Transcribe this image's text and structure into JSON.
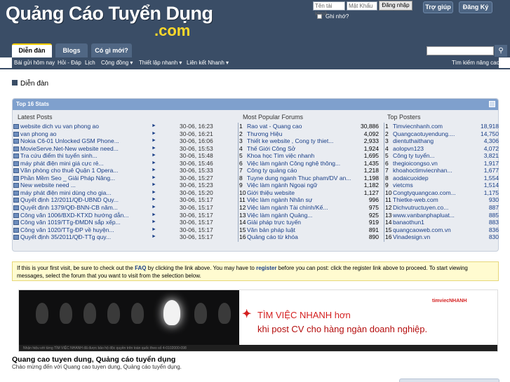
{
  "header": {
    "logo_title": "Quảng Cáo Tuyển Dụng",
    "logo_sub": ".com",
    "username_placeholder": "Tên tài khoả",
    "password_placeholder": "Mật Khẩu",
    "login_label": "Đăng nhập",
    "remember_label": "Ghi nhớ?",
    "help_label": "Trợ giúp",
    "register_label": "Đăng Ký"
  },
  "nav": {
    "tabs": [
      "Diễn đàn",
      "Blogs",
      "Có gì mới?"
    ],
    "subnav": [
      "Bài gửi hôm nay",
      "Hỏi - Đáp",
      "Lịch",
      "Cộng đồng ▾",
      "Thiết lập nhanh ▾",
      "Liên kết Nhanh ▾"
    ],
    "advanced_search": "Tìm kiếm nâng cao"
  },
  "breadcrumb": "Diễn đàn",
  "stats": {
    "title": "Top 16 Stats",
    "headers": {
      "latest": "Latest Posts",
      "popular": "Most Popular Forums",
      "posters": "Top Posters"
    },
    "latest_posts": [
      {
        "title": "website dich vu van phong ao",
        "date": "30-06, 16:23"
      },
      {
        "title": "van phong ao",
        "date": "30-06, 16:21"
      },
      {
        "title": "Nokia C6-01 Unlocked GSM Phone...",
        "date": "30-06, 16:06"
      },
      {
        "title": "MovieServe.Net-New website need...",
        "date": "30-06, 15:53"
      },
      {
        "title": "Tra cứu điểm thi tuyển sinh...",
        "date": "30-06, 15:48"
      },
      {
        "title": "máy phát điện mini giá cực rẻ...",
        "date": "30-06, 15:46"
      },
      {
        "title": "Văn phòng cho thuê Quận 1 Opera...",
        "date": "30-06, 15:33"
      },
      {
        "title": "Phần Mềm Seo _ Giải Pháp Nâng...",
        "date": "30-06, 15:27"
      },
      {
        "title": "New website need ...",
        "date": "30-06, 15:23"
      },
      {
        "title": "máy phát điện mini dùng cho gia...",
        "date": "30-06, 15:20"
      },
      {
        "title": "Quyết định 12/2011/QĐ-UBND Quy...",
        "date": "30-06, 15:17"
      },
      {
        "title": "Quyết định 1379/QĐ-BNN-CB năm...",
        "date": "30-06, 15:17"
      },
      {
        "title": "Công văn 1006/BXD-KTXD hướng dẫn...",
        "date": "30-06, 15:17"
      },
      {
        "title": "Công văn 1019/TTg-ĐMDN sắp xếp...",
        "date": "30-06, 15:17"
      },
      {
        "title": "Công văn 1020/TTg-ĐP về huyện...",
        "date": "30-06, 15:17"
      },
      {
        "title": "Quyết định 35/2011/QĐ-TTg quy...",
        "date": "30-06, 15:17"
      }
    ],
    "popular_forums": [
      {
        "num": "1",
        "title": "Rao vat - Quang cao",
        "count": "30,886"
      },
      {
        "num": "2",
        "title": "Thương Hiệu",
        "count": "4,092"
      },
      {
        "num": "3",
        "title": "Thiết ke website , Cong ty thiet...",
        "count": "2,933"
      },
      {
        "num": "4",
        "title": "Thế Giới Công Sở",
        "count": "1,924"
      },
      {
        "num": "5",
        "title": "Khoa học Tìm việc nhanh",
        "count": "1,695"
      },
      {
        "num": "6",
        "title": "Việc làm ngành Công nghệ thông...",
        "count": "1,435"
      },
      {
        "num": "7",
        "title": "Công ty quảng cáo",
        "count": "1,218"
      },
      {
        "num": "8",
        "title": "Tuyne dung nganh Thuc pham/DV an...",
        "count": "1,198"
      },
      {
        "num": "9",
        "title": "Việc làm ngành Ngoại ngữ",
        "count": "1,182"
      },
      {
        "num": "10",
        "title": "Giới thiệu website",
        "count": "1,127"
      },
      {
        "num": "11",
        "title": "Việc làm ngành Nhân sự",
        "count": "996"
      },
      {
        "num": "12",
        "title": "Việc làm ngành Tài chính/Kế...",
        "count": "975"
      },
      {
        "num": "13",
        "title": "Việc làm ngành Quảng...",
        "count": "925"
      },
      {
        "num": "14",
        "title": "Giải pháp trực tuyến",
        "count": "919"
      },
      {
        "num": "15",
        "title": "Văn bản pháp luật",
        "count": "891"
      },
      {
        "num": "16",
        "title": "Quảng cáo từ khóa",
        "count": "890"
      }
    ],
    "top_posters": [
      {
        "num": "1",
        "name": "Timviecnhanh.com",
        "count": "18,918"
      },
      {
        "num": "2",
        "name": "Quangcaotuyendung....",
        "count": "14,750"
      },
      {
        "num": "3",
        "name": "dientuthaithang",
        "count": "4,306"
      },
      {
        "num": "4",
        "name": "aolopvn123",
        "count": "4,072"
      },
      {
        "num": "5",
        "name": "Công ty tuyển...",
        "count": "3,821"
      },
      {
        "num": "6",
        "name": "thegioicongso.vn",
        "count": "1,917"
      },
      {
        "num": "7",
        "name": "khoahoctimviecnhan...",
        "count": "1,677"
      },
      {
        "num": "8",
        "name": "aodaicuoidep",
        "count": "1,554"
      },
      {
        "num": "9",
        "name": "vietcms",
        "count": "1,514"
      },
      {
        "num": "10",
        "name": "Congtyquangcao.com...",
        "count": "1,175"
      },
      {
        "num": "11",
        "name": "Thietke-web.com",
        "count": "930"
      },
      {
        "num": "12",
        "name": "Dichvutructuyen.co...",
        "count": "887"
      },
      {
        "num": "13",
        "name": "www.vanbanphapluat...",
        "count": "885"
      },
      {
        "num": "14",
        "name": "banaothun1",
        "count": "883"
      },
      {
        "num": "15",
        "name": "quangcaoweb.com.vn",
        "count": "836"
      },
      {
        "num": "16",
        "name": "Vinadesign.vn",
        "count": "830"
      }
    ]
  },
  "notice": {
    "p1": "If this is your first visit, be sure to check out the ",
    "faq": "FAQ",
    "p2": " by clicking the link above. You may have to ",
    "register": "register",
    "p3": " before you can post: click the register link above to proceed. To start viewing messages, select the forum that you want to visit from the selection below."
  },
  "banner": {
    "line1": "TÌM VIỆC NHANH hơn",
    "line2": "khi post CV cho hàng ngàn doanh nghiệp.",
    "logo": "timviecNHANH",
    "caption": "Nhận hiệu với từng TÌM VIỆC NHANH đã được bảo hộ độc quyền trên toàn quốc theo số 4-0102000-098"
  },
  "site": {
    "heading": "Quang cao tuyen dung, Quảng cáo tuyển dụng",
    "description": "Chào mừng đến với Quang cao tuyen dung, Quảng cáo tuyển dụng."
  }
}
